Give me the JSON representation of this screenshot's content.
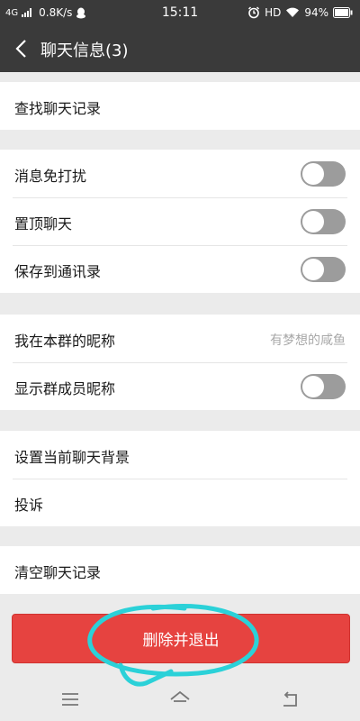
{
  "status": {
    "network": "4G",
    "speed": "0.8K/s",
    "time": "15:11",
    "hd": "HD",
    "battery": "94%",
    "icons": [
      "signal-icon",
      "qq-icon",
      "alarm-icon",
      "wifi-icon",
      "battery-icon"
    ]
  },
  "nav": {
    "title": "聊天信息(3)"
  },
  "groups": {
    "search": {
      "label": "查找聊天记录"
    },
    "settings": {
      "mute": {
        "label": "消息免打扰",
        "on": false
      },
      "pin": {
        "label": "置顶聊天",
        "on": false
      },
      "save": {
        "label": "保存到通讯录",
        "on": false
      }
    },
    "profile": {
      "nickname": {
        "label": "我在本群的昵称",
        "value": "有梦想的咸鱼"
      },
      "show_names": {
        "label": "显示群成员昵称",
        "on": false
      }
    },
    "misc": {
      "background": {
        "label": "设置当前聊天背景"
      },
      "report": {
        "label": "投诉"
      }
    },
    "clear": {
      "label": "清空聊天记录"
    }
  },
  "actions": {
    "delete_exit": "删除并退出"
  },
  "colors": {
    "header": "#3a3a3a",
    "danger": "#e64340",
    "toggle_off": "#9c9c9c",
    "annotation": "#2bd1d8"
  }
}
